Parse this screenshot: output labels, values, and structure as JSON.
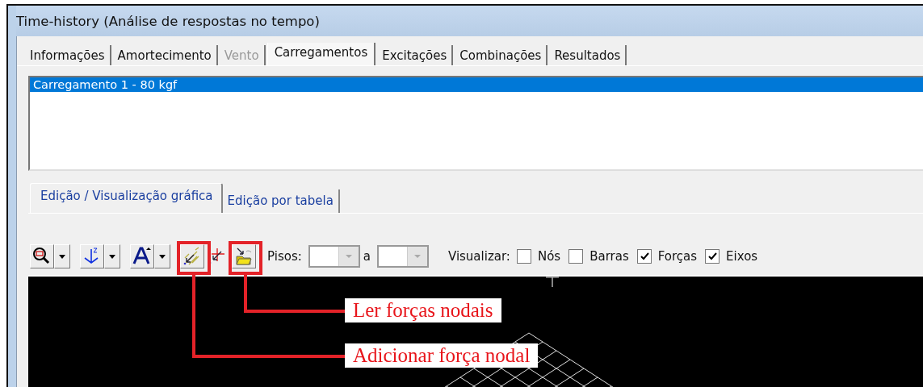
{
  "window": {
    "title": "Time-history (Análise de respostas no tempo)"
  },
  "tabs": [
    {
      "label": "Informações",
      "selected": false,
      "disabled": false
    },
    {
      "label": "Amortecimento",
      "selected": false,
      "disabled": false
    },
    {
      "label": "Vento",
      "selected": false,
      "disabled": true
    },
    {
      "label": "Carregamentos",
      "selected": true,
      "disabled": false
    },
    {
      "label": "Excitações",
      "selected": false,
      "disabled": false
    },
    {
      "label": "Combinações",
      "selected": false,
      "disabled": false
    },
    {
      "label": "Resultados",
      "selected": false,
      "disabled": false
    }
  ],
  "loads": [
    {
      "label": "Carregamento 1 - 80 kgf",
      "selected": true
    }
  ],
  "subtabs": [
    {
      "label": "Edição / Visualização gráfica",
      "selected": true
    },
    {
      "label": "Edição por tabela",
      "selected": false
    }
  ],
  "toolbar": {
    "tools": [
      {
        "kind": "zoom",
        "dropdown": true,
        "highlighted": false
      },
      {
        "kind": "axes",
        "dropdown": true,
        "highlighted": false
      },
      {
        "kind": "text",
        "dropdown": true,
        "highlighted": false
      },
      {
        "kind": "add-force",
        "dropdown": false,
        "highlighted": true
      },
      {
        "kind": "move-force",
        "dropdown": false,
        "highlighted": false
      },
      {
        "kind": "read-forces",
        "dropdown": false,
        "highlighted": true
      }
    ],
    "floors_label": "Pisos:",
    "floors_between": "a",
    "view_label": "Visualizar:",
    "view_options": [
      {
        "label": "Nós",
        "checked": false
      },
      {
        "label": "Barras",
        "checked": false
      },
      {
        "label": "Forças",
        "checked": true
      },
      {
        "label": "Eixos",
        "checked": true
      }
    ]
  },
  "callouts": [
    {
      "text": "Ler forças nodais"
    },
    {
      "text": "Adicionar força nodal"
    }
  ]
}
